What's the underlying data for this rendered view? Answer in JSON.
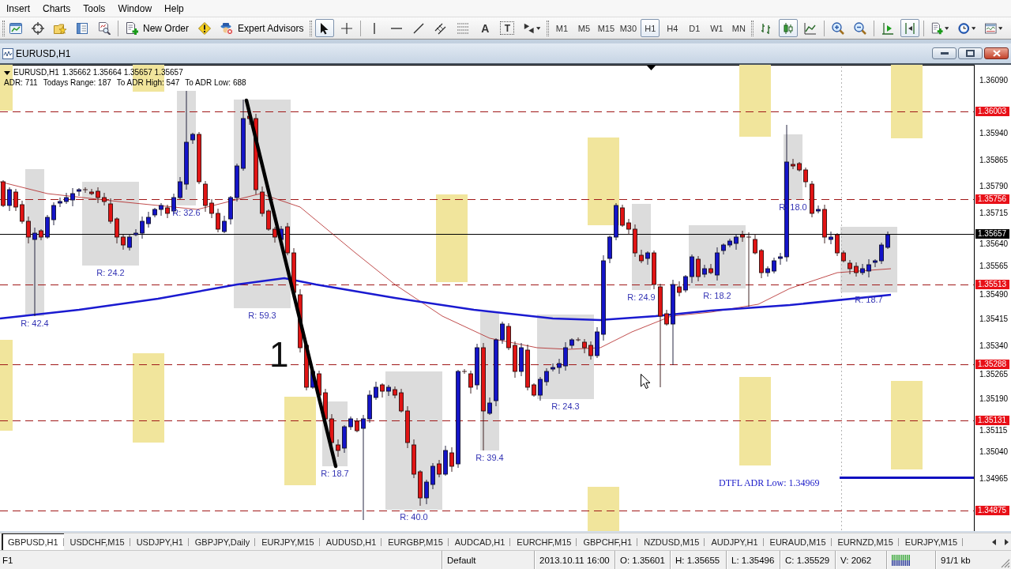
{
  "menu": [
    {
      "label": "Insert"
    },
    {
      "label": "Charts"
    },
    {
      "label": "Tools"
    },
    {
      "label": "Window"
    },
    {
      "label": "Help"
    }
  ],
  "toolbar": {
    "new_order": "New Order",
    "expert_advisors": "Expert Advisors",
    "cursor_modes": [
      {
        "kind": "cursor",
        "selected": true
      },
      {
        "kind": "crosshair",
        "selected": false
      }
    ],
    "text_tools": [
      {
        "kind": "text",
        "glyph": "A"
      },
      {
        "kind": "label",
        "glyph": "T"
      }
    ],
    "timeframes": [
      {
        "label": "M1",
        "selected": false
      },
      {
        "label": "M5",
        "selected": false
      },
      {
        "label": "M15",
        "selected": false
      },
      {
        "label": "M30",
        "selected": false
      },
      {
        "label": "H1",
        "selected": true
      },
      {
        "label": "H4",
        "selected": false
      },
      {
        "label": "D1",
        "selected": false
      },
      {
        "label": "W1",
        "selected": false
      },
      {
        "label": "MN",
        "selected": false
      }
    ],
    "chart_types": [
      {
        "kind": "bars",
        "selected": false
      },
      {
        "kind": "candles",
        "selected": true
      },
      {
        "kind": "line",
        "selected": false
      }
    ],
    "scroll_modes": [
      {
        "kind": "shift",
        "on": false
      },
      {
        "kind": "autoscroll",
        "on": true
      }
    ]
  },
  "chart_window": {
    "title": "EURUSD,H1",
    "chart": {
      "symbol": "EURUSD,H1",
      "quotes": "1.35662 1.35664 1.35657 1.35657",
      "stats": [
        "ADR: 711",
        "Todays Range: 187",
        "To ADR High: 547",
        "To ADR Low: 688"
      ],
      "price_axis": [
        "1.36090",
        "1.35940",
        "1.35865",
        "1.35790",
        "1.35715",
        "1.35640",
        "1.35565",
        "1.35490",
        "1.35415",
        "1.35340",
        "1.35265",
        "1.35190",
        "1.35115",
        "1.35040",
        "1.34965"
      ],
      "levels": [
        "1.36003",
        "1.35756",
        "1.35513",
        "1.35288",
        "1.35131",
        "1.34875"
      ],
      "current_price": "1.35657",
      "ranges": [
        "R: 42.4",
        "R: 24.2",
        "R: 32.6",
        "R: 59.3",
        "R: 18.7",
        "R: 40.0",
        "R: 39.4",
        "R: 24.3",
        "R: 24.9",
        "R: 18.2",
        "R: 18.0",
        "R: 18.7"
      ],
      "adr_low": "DTFL ADR Low: 1.34969",
      "annotation": "1"
    }
  },
  "symbol_tabs": [
    {
      "label": "GBPUSD,H1",
      "selected": true
    },
    {
      "label": "USDCHF,M15",
      "selected": false
    },
    {
      "label": "USDJPY,H1",
      "selected": false
    },
    {
      "label": "GBPJPY,Daily",
      "selected": false
    },
    {
      "label": "EURJPY,M15",
      "selected": false
    },
    {
      "label": "AUDUSD,H1",
      "selected": false
    },
    {
      "label": "EURGBP,M15",
      "selected": false
    },
    {
      "label": "AUDCAD,H1",
      "selected": false
    },
    {
      "label": "EURCHF,M15",
      "selected": false
    },
    {
      "label": "GBPCHF,H1",
      "selected": false
    },
    {
      "label": "NZDUSD,M15",
      "selected": false
    },
    {
      "label": "AUDJPY,H1",
      "selected": false
    },
    {
      "label": "EURAUD,M15",
      "selected": false
    },
    {
      "label": "EURNZD,M15",
      "selected": false
    },
    {
      "label": "EURJPY,M15",
      "selected": false
    }
  ],
  "status_bar": {
    "help": "F1",
    "profile": "Default",
    "time": "2013.10.11 16:00",
    "open": "O: 1.35601",
    "high": "H: 1.35655",
    "low": "L: 1.35496",
    "close": "C: 1.35529",
    "volume": "V: 2062",
    "traffic": "91/1 kb"
  }
}
